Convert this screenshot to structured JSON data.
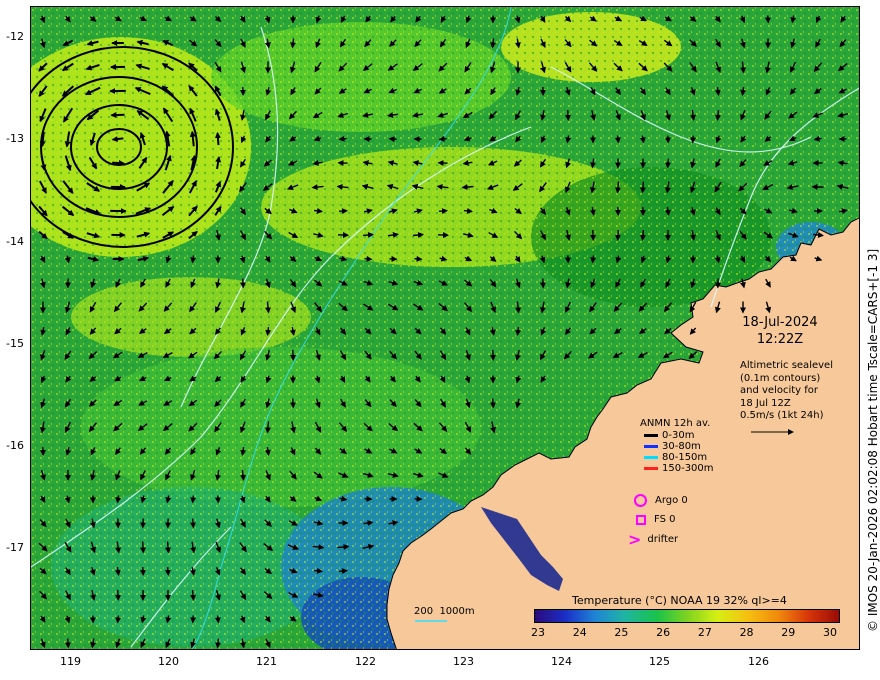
{
  "map": {
    "lon_ticks": [
      "119",
      "120",
      "121",
      "122",
      "123",
      "124",
      "125",
      "126"
    ],
    "lat_ticks": [
      "-12",
      "-13",
      "-14",
      "-15",
      "-16",
      "-17"
    ],
    "lon_range": [
      118.55,
      126.85
    ],
    "lat_range": [
      -11.9,
      -17.95
    ],
    "land_color": "#f7c99a",
    "sea_colors": [
      "#0b8f20",
      "#5fd12b",
      "#c8f016",
      "#33b879",
      "#1f5fc9"
    ]
  },
  "overlay": {
    "date": "18-Jul-2024",
    "time": "12:22Z",
    "alt_note": [
      "Altimetric sealevel",
      "(0.1m contours)",
      "and velocity for",
      "18 Jul 12Z",
      "0.5m/s (1kt 24h)"
    ]
  },
  "legend": {
    "title": "ANMN 12h av.",
    "items": [
      {
        "label": "0-30m",
        "color": "#000000"
      },
      {
        "label": "30-80m",
        "color": "#1030ff"
      },
      {
        "label": "80-150m",
        "color": "#00ddff"
      },
      {
        "label": "150-300m",
        "color": "#ff2020"
      }
    ],
    "argo": "Argo 0",
    "fs": "FS 0",
    "drifter": "drifter",
    "marker_color": "#ff00ff"
  },
  "colorbar": {
    "title": "Temperature (°C) NOAA 19 32% ql>=4",
    "ticks": [
      "23",
      "24",
      "25",
      "26",
      "27",
      "28",
      "29",
      "30"
    ],
    "stops": [
      "#2a0a7a",
      "#1b2fc7",
      "#1f86d6",
      "#1fb6a0",
      "#19c24c",
      "#7ed321",
      "#d6ef14",
      "#f6c010",
      "#f08a0c",
      "#d8360a",
      "#9a0a05"
    ]
  },
  "scale_bar": {
    "label": "200  1000m"
  },
  "credit": "© IMOS 20-Jan-2026 02:02:08 Hobart time Tscale=CARS+[-1 3]"
}
